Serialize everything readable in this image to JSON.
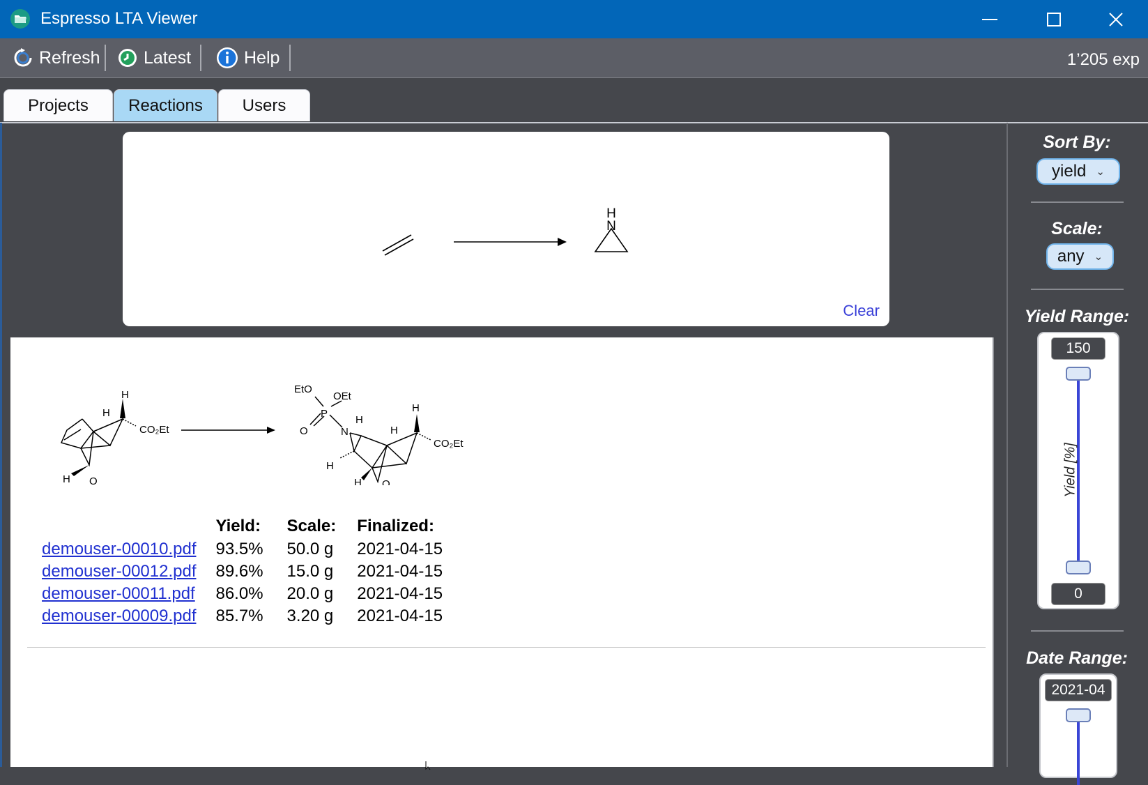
{
  "window": {
    "title": "Espresso LTA Viewer"
  },
  "toolbar": {
    "refresh_label": "Refresh",
    "latest_label": "Latest",
    "help_label": "Help",
    "exp_count": "1’205 exp"
  },
  "tabs": [
    {
      "label": "Projects",
      "active": false
    },
    {
      "label": "Reactions",
      "active": true
    },
    {
      "label": "Users",
      "active": false
    }
  ],
  "query": {
    "clear_label": "Clear",
    "product_label_h": "H",
    "product_label_n": "N"
  },
  "reaction": {
    "reactant_labels": {
      "h_top": "H",
      "h_mid": "H",
      "h_bottom": "H",
      "o": "O",
      "ester": "CO₂Et"
    },
    "product_labels": {
      "eto": "EtO",
      "oet": "OEt",
      "p": "P",
      "o_dbl": "O",
      "n": "N",
      "h1": "H",
      "h2": "H",
      "h3": "H",
      "h4": "H",
      "h5": "H",
      "o": "O",
      "ester": "CO₂Et"
    }
  },
  "results": {
    "headers": {
      "yield": "Yield:",
      "scale": "Scale:",
      "finalized": "Finalized:"
    },
    "rows": [
      {
        "file": "demouser-00010.pdf",
        "yield": "93.5%",
        "scale": "50.0 g",
        "finalized": "2021-04-15"
      },
      {
        "file": "demouser-00012.pdf",
        "yield": "89.6%",
        "scale": "15.0 g",
        "finalized": "2021-04-15"
      },
      {
        "file": "demouser-00011.pdf",
        "yield": "86.0%",
        "scale": "20.0 g",
        "finalized": "2021-04-15"
      },
      {
        "file": "demouser-00009.pdf",
        "yield": "85.7%",
        "scale": "3.20 g",
        "finalized": "2021-04-15"
      }
    ]
  },
  "sidebar": {
    "sort_by_label": "Sort By:",
    "sort_by_value": "yield",
    "scale_label": "Scale:",
    "scale_value": "any",
    "yield_range_label": "Yield Range:",
    "yield_max": "150",
    "yield_min": "0",
    "yield_axis_caption": "Yield [%]",
    "date_range_label": "Date Range:",
    "date_max": "2021-04"
  },
  "colors": {
    "titlebar": "#0266b8",
    "toolbar": "#5c5e66",
    "background": "#45474c",
    "active_tab": "#a9d8f5",
    "link": "#2030d0",
    "slider_track": "#3a45d6"
  }
}
